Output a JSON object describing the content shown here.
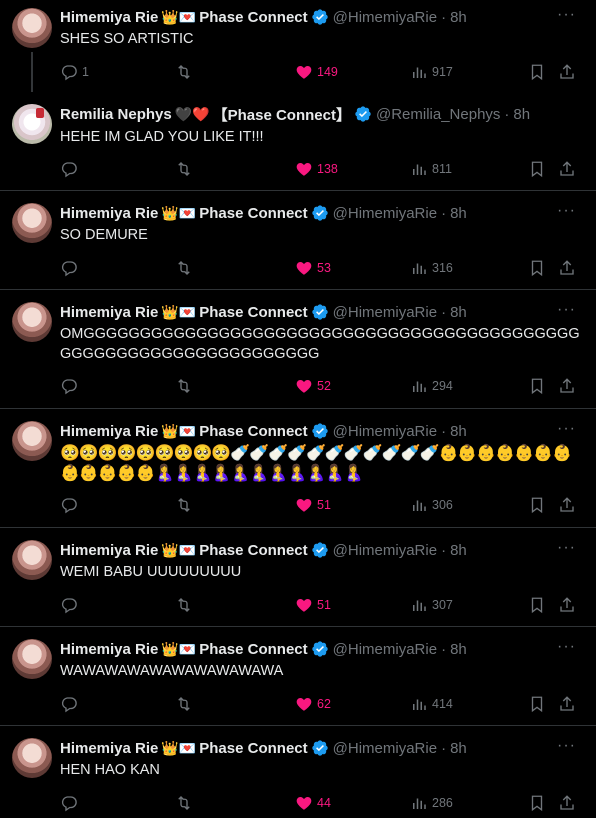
{
  "affiliation": "Phase Connect",
  "tweets": [
    {
      "name": "Himemiya Rie",
      "emoji": "👑💌",
      "affiliation": "Phase Connect",
      "handle": "@HimemiyaRie",
      "time": "8h",
      "text": "SHES SO ARTISTIC",
      "replies": "1",
      "retweets": "",
      "likes": "149",
      "views": "917",
      "avatar": "rie"
    },
    {
      "name": "Remilia Nephys",
      "emoji": "🖤❤️",
      "affiliation": "【Phase Connect】",
      "handle": "@Remilia_Nephys",
      "time": "8h",
      "text": "HEHE IM GLAD YOU LIKE IT!!!",
      "replies": "",
      "retweets": "",
      "likes": "138",
      "views": "811",
      "avatar": "nephys"
    },
    {
      "name": "Himemiya Rie",
      "emoji": "👑💌",
      "affiliation": "Phase Connect",
      "handle": "@HimemiyaRie",
      "time": "8h",
      "text": "SO DEMURE",
      "replies": "",
      "retweets": "",
      "likes": "53",
      "views": "316",
      "avatar": "rie"
    },
    {
      "name": "Himemiya Rie",
      "emoji": "👑💌",
      "affiliation": "Phase Connect",
      "handle": "@HimemiyaRie",
      "time": "8h",
      "text": "OMGGGGGGGGGGGGGGGGGGGGGGGGGGGGGGGGGGGGGGGGGGGGGGGGGGGGGGGGGGGGGGGGGGG",
      "replies": "",
      "retweets": "",
      "likes": "52",
      "views": "294",
      "avatar": "rie"
    },
    {
      "name": "Himemiya Rie",
      "emoji": "👑💌",
      "affiliation": "Phase Connect",
      "handle": "@HimemiyaRie",
      "time": "8h",
      "text": "🥺🥺🥺🥺🥺🥺🥺🥺🥺🍼🍼🍼🍼🍼🍼🍼🍼🍼🍼🍼👶👶👶👶👶👶👶👶👶👶👶👶🤱🤱🤱🤱🤱🤱🤱🤱🤱🤱🤱",
      "replies": "",
      "retweets": "",
      "likes": "51",
      "views": "306",
      "avatar": "rie"
    },
    {
      "name": "Himemiya Rie",
      "emoji": "👑💌",
      "affiliation": "Phase Connect",
      "handle": "@HimemiyaRie",
      "time": "8h",
      "text": "WEMI BABU UUUUUUUUU",
      "replies": "",
      "retweets": "",
      "likes": "51",
      "views": "307",
      "avatar": "rie"
    },
    {
      "name": "Himemiya Rie",
      "emoji": "👑💌",
      "affiliation": "Phase Connect",
      "handle": "@HimemiyaRie",
      "time": "8h",
      "text": "WAWAWAWAWAWAWAWAWAWA",
      "replies": "",
      "retweets": "",
      "likes": "62",
      "views": "414",
      "avatar": "rie"
    },
    {
      "name": "Himemiya Rie",
      "emoji": "👑💌",
      "affiliation": "Phase Connect",
      "handle": "@HimemiyaRie",
      "time": "8h",
      "text": "HEN HAO KAN",
      "replies": "",
      "retweets": "",
      "likes": "44",
      "views": "286",
      "avatar": "rie"
    }
  ],
  "colors": {
    "background": "#000000",
    "like": "#f91880",
    "muted": "#71767b",
    "verified": "#1d9bf0",
    "divider": "#2f3336"
  },
  "icons": [
    "reply-icon",
    "retweet-icon",
    "like-icon",
    "views-icon",
    "bookmark-icon",
    "share-icon",
    "more-icon",
    "verified-badge-icon"
  ]
}
